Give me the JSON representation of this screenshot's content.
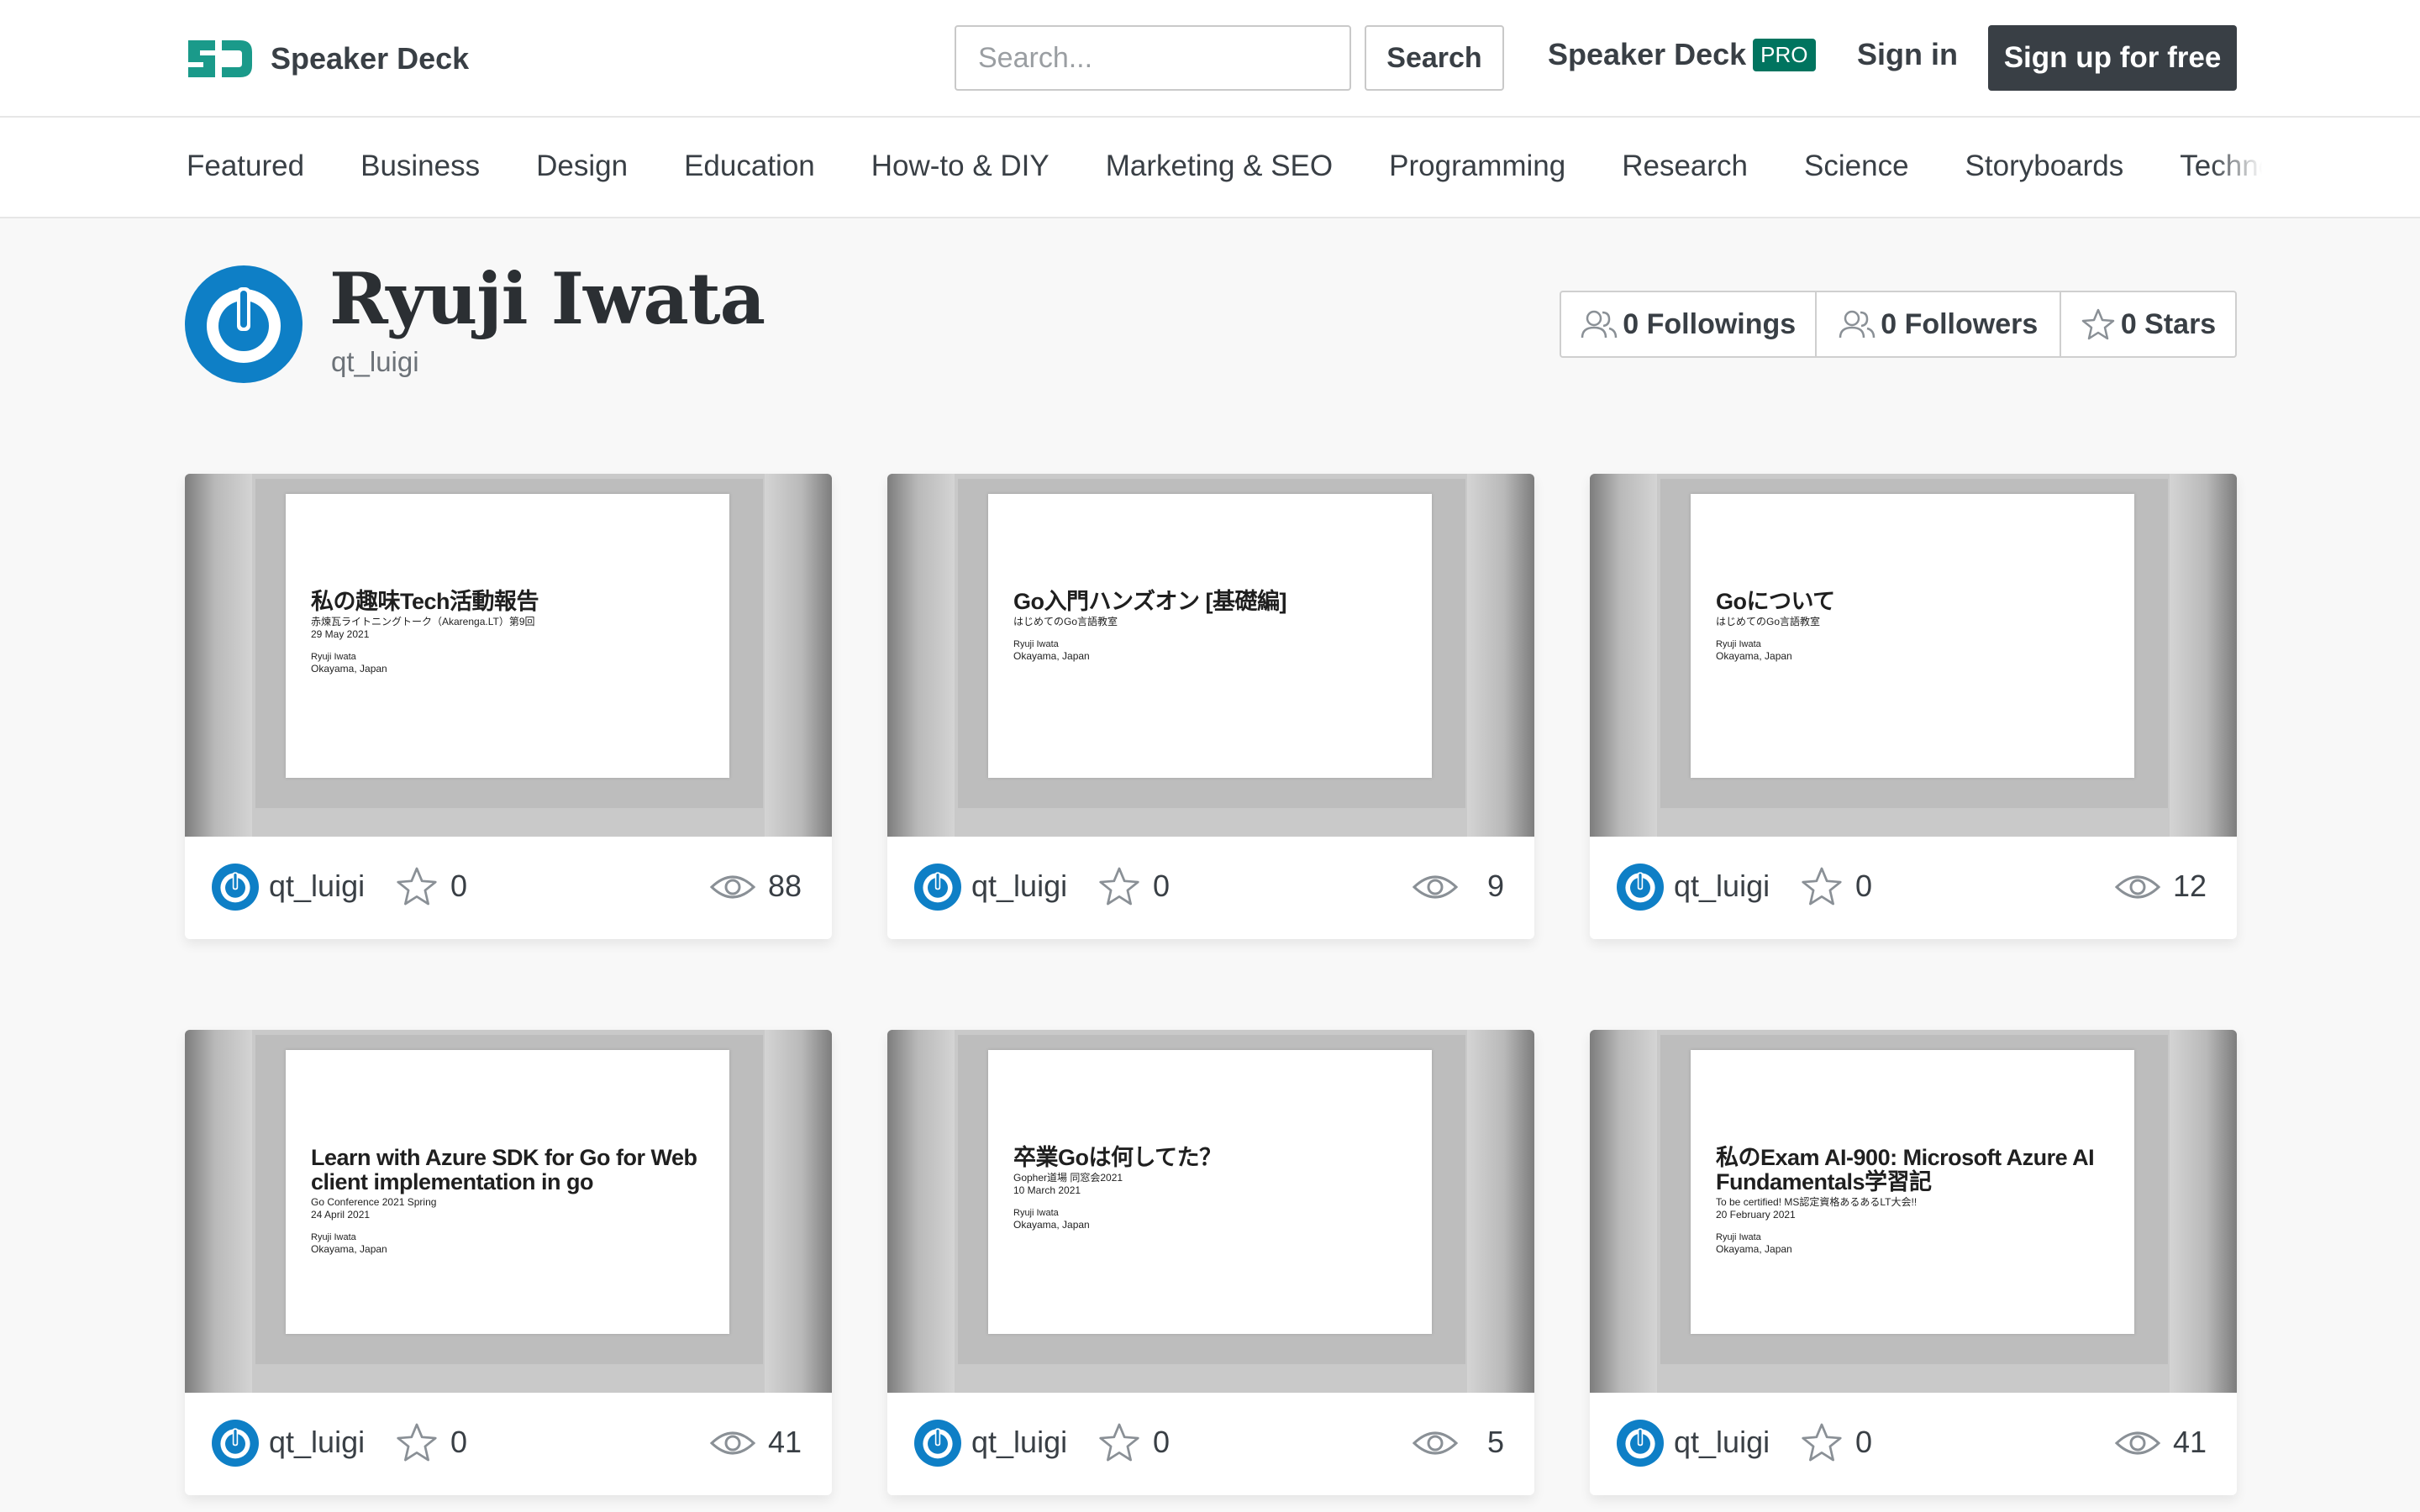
{
  "header": {
    "brand": "Speaker Deck",
    "search_placeholder": "Search...",
    "search_button": "Search",
    "pro_link": "Speaker Deck",
    "pro_badge": "PRO",
    "sign_in": "Sign in",
    "sign_up": "Sign up for free",
    "brand_color": "#1a9a8a"
  },
  "categories": [
    "Featured",
    "Business",
    "Design",
    "Education",
    "How-to & DIY",
    "Marketing & SEO",
    "Programming",
    "Research",
    "Science",
    "Storyboards",
    "Technology"
  ],
  "profile": {
    "name": "Ryuji Iwata",
    "handle": "qt_luigi",
    "avatar_color": "#0e7fc6",
    "stats": {
      "followings": "0 Followings",
      "followers": "0 Followers",
      "stars": "0 Stars"
    }
  },
  "decks": [
    {
      "title": "私の趣味Tech活動報告",
      "subtitle": "赤煉瓦ライトニングトーク（Akarenga.LT）第9回",
      "date": "29 May 2021",
      "author": "Ryuji Iwata",
      "location": "Okayama, Japan",
      "user": "qt_luigi",
      "stars": "0",
      "views": "88"
    },
    {
      "title": "Go入門ハンズオン [基礎編]",
      "subtitle": "はじめてのGo言語教室",
      "date": "",
      "author": "Ryuji Iwata",
      "location": "Okayama, Japan",
      "user": "qt_luigi",
      "stars": "0",
      "views": "9"
    },
    {
      "title": "Goについて",
      "subtitle": "はじめてのGo言語教室",
      "date": "",
      "author": "Ryuji Iwata",
      "location": "Okayama, Japan",
      "user": "qt_luigi",
      "stars": "0",
      "views": "12"
    },
    {
      "title": "Learn with Azure SDK for Go for Web client implementation in go",
      "subtitle": "Go Conference 2021 Spring",
      "date": "24 April 2021",
      "author": "Ryuji Iwata",
      "location": "Okayama, Japan",
      "user": "qt_luigi",
      "stars": "0",
      "views": "41"
    },
    {
      "title": "卒業Goは何してた？",
      "subtitle": "Gopher道場 同窓会2021",
      "date": "10 March 2021",
      "author": "Ryuji Iwata",
      "location": "Okayama, Japan",
      "user": "qt_luigi",
      "stars": "0",
      "views": "5"
    },
    {
      "title": "私のExam AI-900: Microsoft Azure AI Fundamentals学習記",
      "subtitle": "To be certified! MS認定資格あるあるLT大会!!",
      "date": "20 February 2021",
      "author": "Ryuji Iwata",
      "location": "Okayama, Japan",
      "user": "qt_luigi",
      "stars": "0",
      "views": "41"
    }
  ]
}
